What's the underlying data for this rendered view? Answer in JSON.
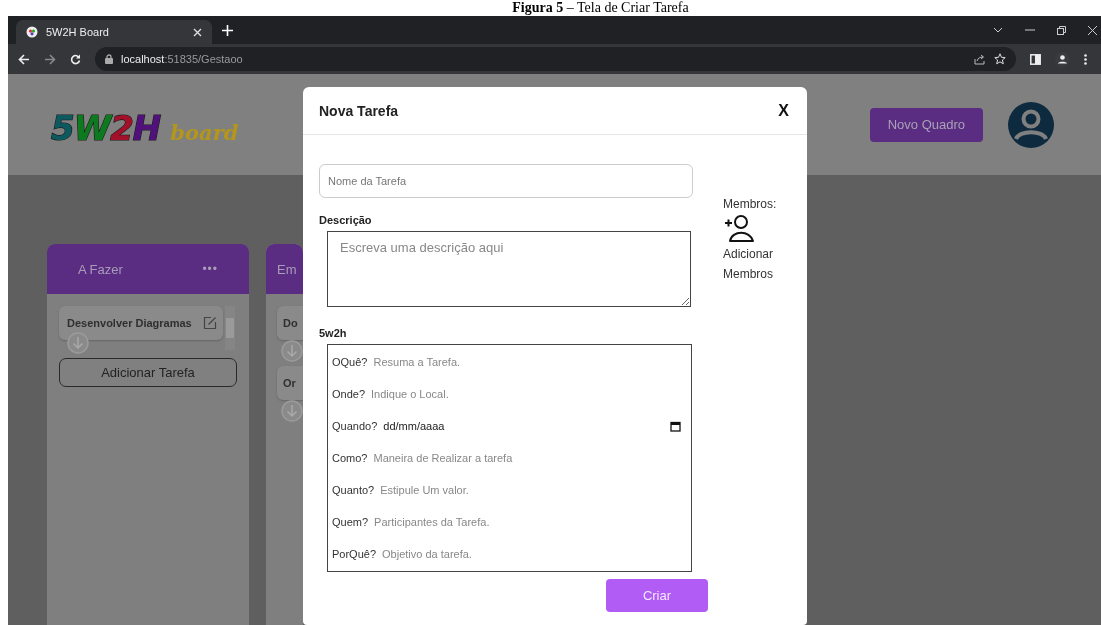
{
  "caption": "**Figura 5** – Tela de Criar Tarefa",
  "browser": {
    "tabs": [
      {
        "title": "5W2H Board",
        "selected": true
      }
    ],
    "url_host": "localhost",
    "url_rest": ":51835/Gestaoo"
  },
  "header": {
    "logo": {
      "letters": [
        {
          "text": "5",
          "color": "#0c5a60"
        },
        {
          "text": "W",
          "color": "#0e7a20"
        },
        {
          "text": "2",
          "color": "#a3102a"
        },
        {
          "text": "H",
          "color": "#50127a"
        }
      ],
      "sub": "board"
    },
    "new_board_button": "Novo Quadro"
  },
  "columns": [
    {
      "title": "A Fazer",
      "menu": "•••",
      "cards": [
        {
          "title": "Desenvolver Diagramas"
        }
      ],
      "add_button": "Adicionar Tarefa"
    },
    {
      "title": "Em",
      "cards": [
        {
          "title": "Do"
        },
        {
          "title": "Or"
        }
      ]
    }
  ],
  "modal": {
    "title": "Nova Tarefa",
    "close": "X",
    "name_placeholder": "Nome da Tarefa",
    "description_label": "Descrição",
    "description_placeholder": "Escreva uma descrição aqui",
    "section_label": "5w2h",
    "rows": [
      {
        "kind": "text",
        "label": "OQuê?",
        "placeholder": "Resuma a Tarefa."
      },
      {
        "kind": "text",
        "label": "Onde?",
        "placeholder": "Indique o Local."
      },
      {
        "kind": "date",
        "label": "Quando?",
        "value": "dd/mm/aaaa"
      },
      {
        "kind": "text",
        "label": "Como?",
        "placeholder": "Maneira de Realizar a tarefa"
      },
      {
        "kind": "text",
        "label": "Quanto?",
        "placeholder": "Estipule Um valor."
      },
      {
        "kind": "text",
        "label": "Quem?",
        "placeholder": "Participantes da Tarefa."
      },
      {
        "kind": "text",
        "label": "PorQuê?",
        "placeholder": "Objetivo da tarefa."
      }
    ],
    "members_label": "Membros:",
    "add_members": "Adicionar Membros",
    "submit": "Criar"
  }
}
